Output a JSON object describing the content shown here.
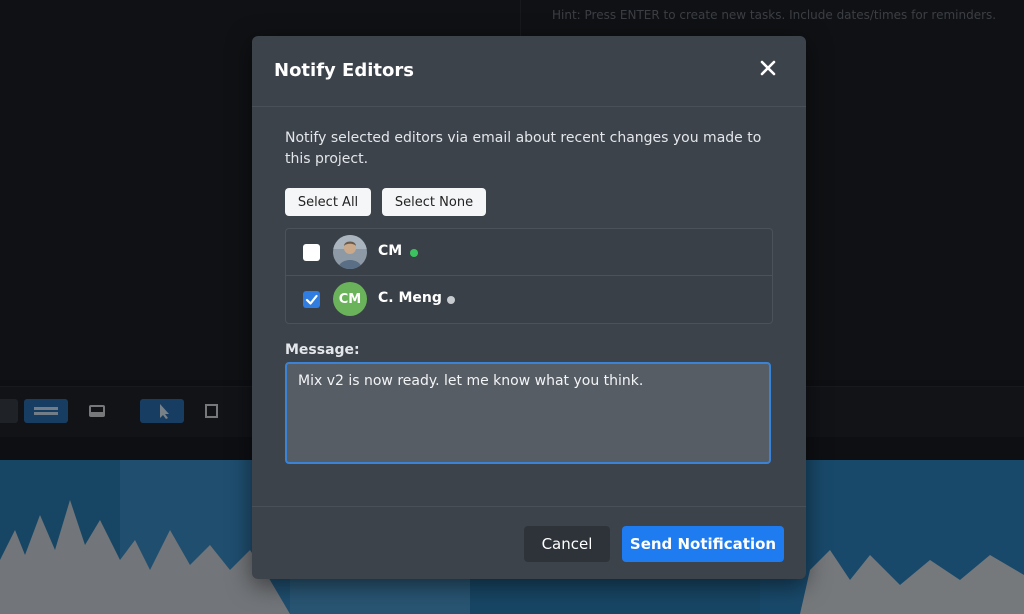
{
  "background": {
    "hint": "Hint: Press ENTER to create new tasks. Include dates/times for reminders."
  },
  "modal": {
    "title": "Notify Editors",
    "description": "Notify selected editors via email about recent changes you made to this project.",
    "select_all_label": "Select All",
    "select_none_label": "Select None",
    "editors": [
      {
        "name": "CM",
        "checked": false,
        "online": true,
        "avatar": "photo",
        "status_color": "#3cc35f"
      },
      {
        "name": "C. Meng",
        "initials": "CM",
        "checked": true,
        "online": false,
        "avatar": "initials",
        "status_color": "#c7cbcf"
      }
    ],
    "message_label": "Message:",
    "message_value": "Mix v2 is now ready. let me know what you think.",
    "cancel_label": "Cancel",
    "send_label": "Send Notification"
  },
  "colors": {
    "accent": "#1e7cf0",
    "online": "#3cc35f",
    "offline": "#c7cbcf",
    "initials_avatar": "#6bb35a"
  }
}
